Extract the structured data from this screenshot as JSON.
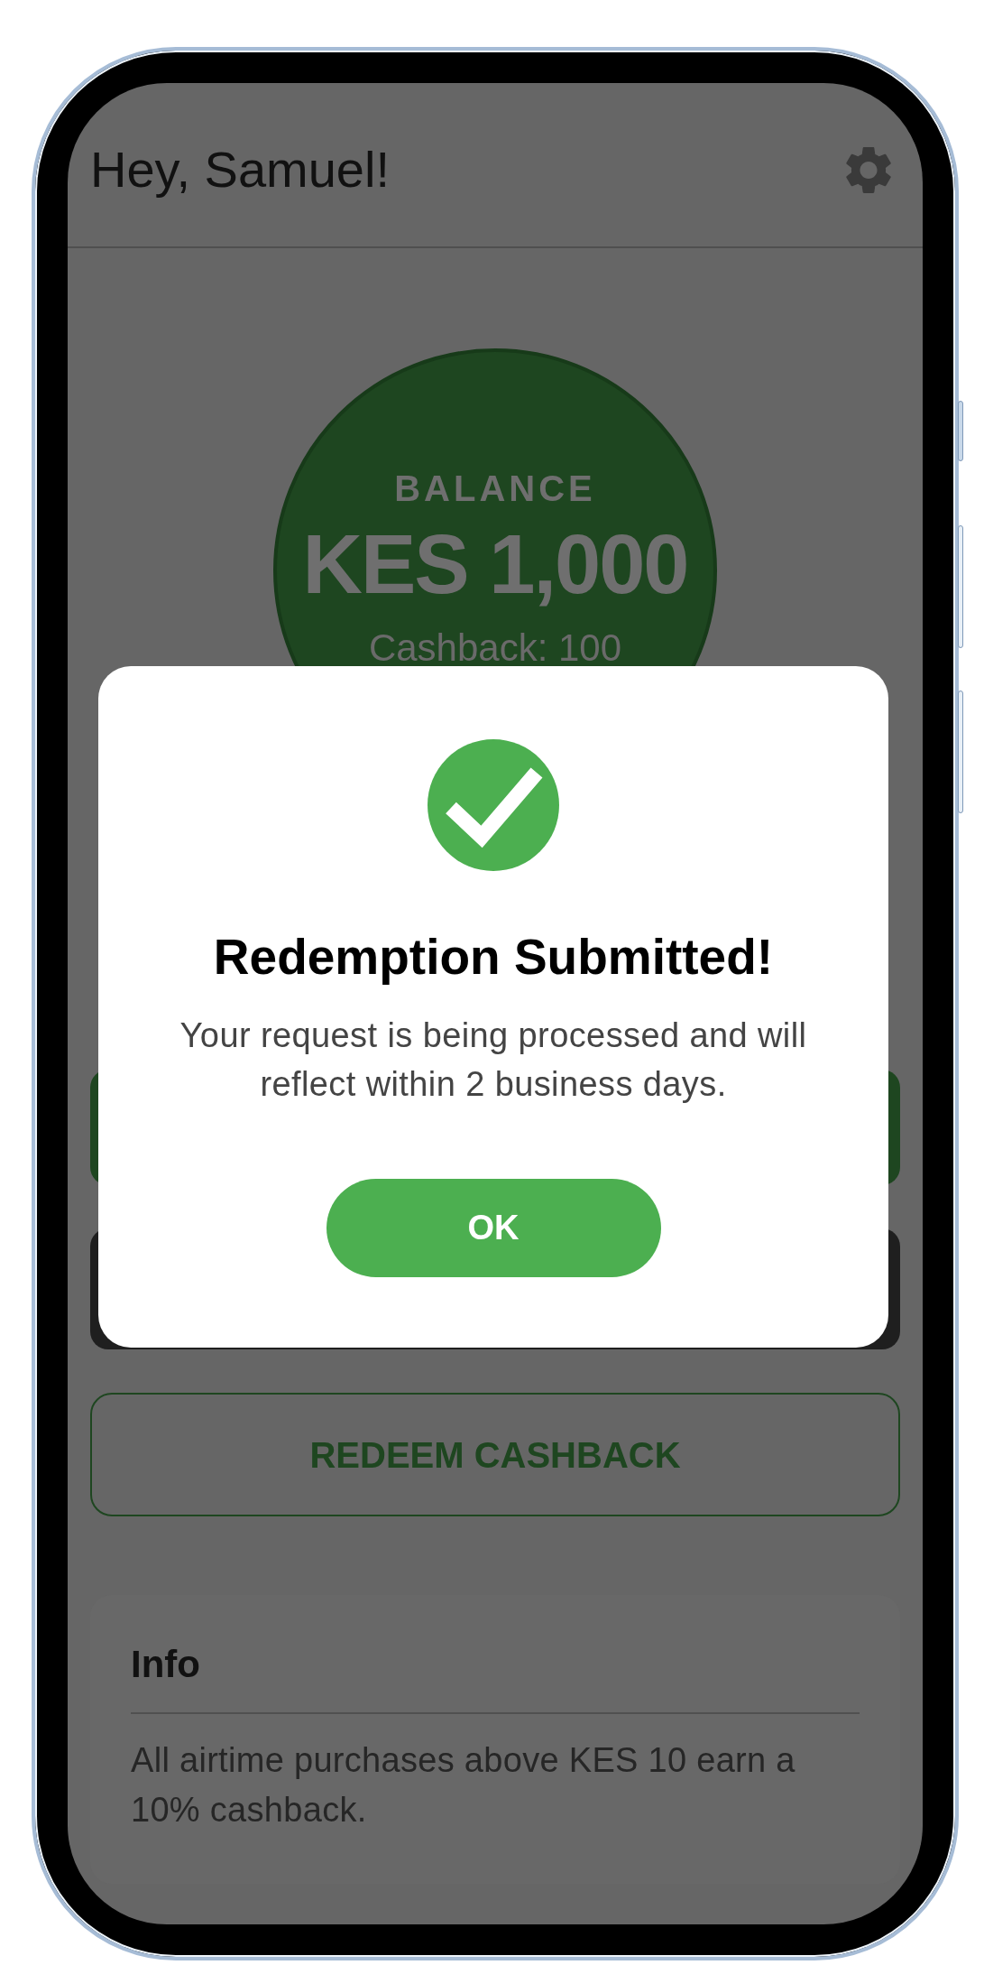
{
  "header": {
    "greeting": "Hey, Samuel!"
  },
  "balance": {
    "label": "BALANCE",
    "amount": "KES 1,000",
    "cashback": "Cashback: 100"
  },
  "buttons": [
    {
      "kind": "filled"
    },
    {
      "kind": "dark"
    },
    {
      "kind": "outlined",
      "label": "REDEEM CASHBACK"
    }
  ],
  "info": {
    "title": "Info",
    "text": "All airtime purchases above KES 10 earn a 10% cashback."
  },
  "dialog": {
    "title": "Redemption Submitted!",
    "message": "Your request is being processed and will reflect within 2 business days.",
    "button": "OK"
  }
}
